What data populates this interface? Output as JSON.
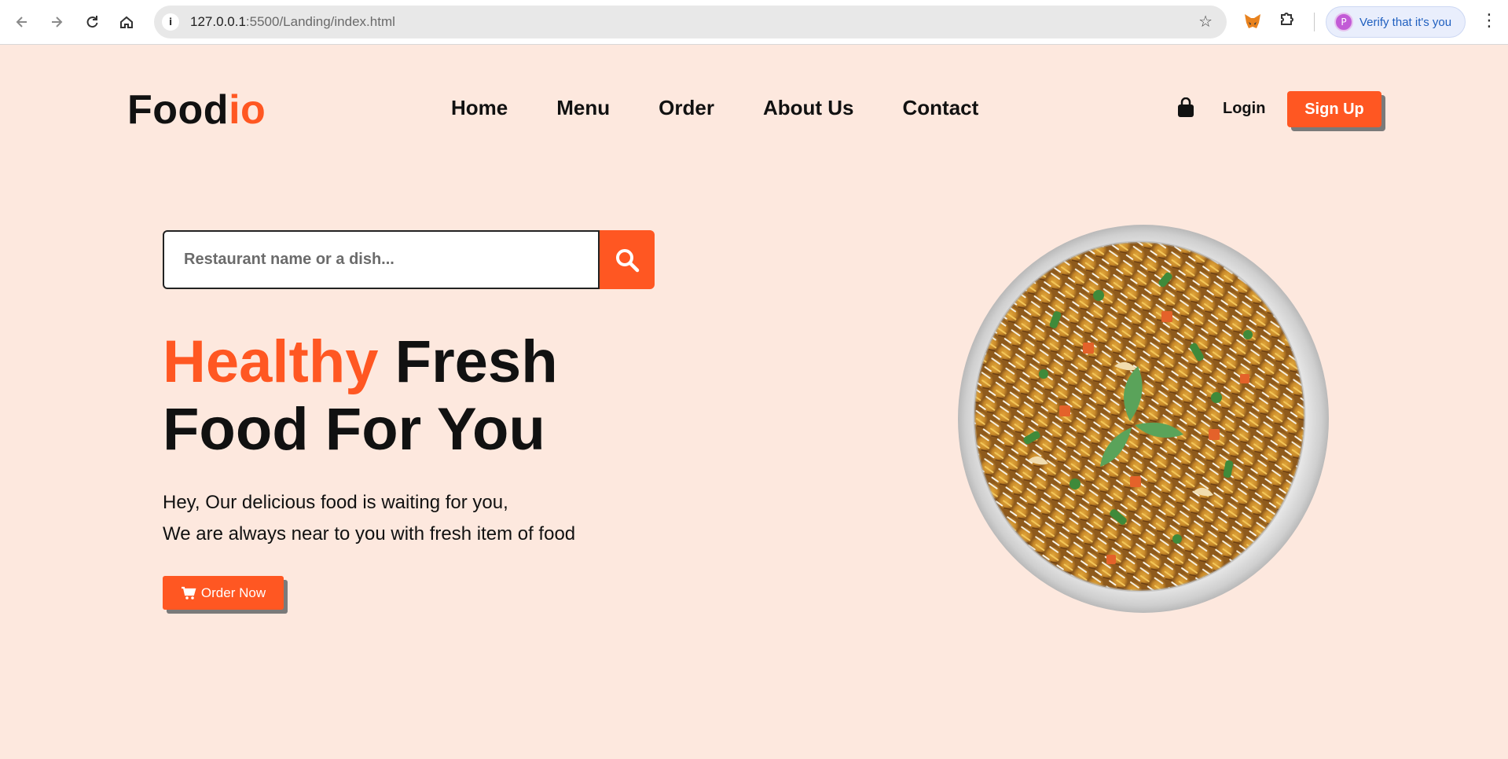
{
  "browser": {
    "url_host": "127.0.0.1",
    "url_path": ":5500/Landing/index.html",
    "profile_label": "Verify that it's you",
    "profile_initial": "P",
    "icons": [
      "back-icon",
      "forward-icon",
      "reload-icon",
      "home-icon",
      "site-info-icon",
      "bookmark-star-icon",
      "metamask-fox-icon",
      "extensions-puzzle-icon",
      "more-menu-icon"
    ]
  },
  "brand": {
    "prefix": "Food",
    "suffix": "io"
  },
  "nav": [
    "Home",
    "Menu",
    "Order",
    "About Us",
    "Contact"
  ],
  "header_actions": {
    "login": "Login",
    "signup": "Sign Up",
    "cart_icon": "shopping-bag-icon"
  },
  "search": {
    "placeholder": "Restaurant name or a dish...",
    "value": "",
    "icon": "search-icon"
  },
  "hero": {
    "headline_accent": "Healthy",
    "headline_rest_1": " Fresh",
    "headline_line_2": "Food For You",
    "desc_line_1": "Hey, Our delicious food is waiting for you,",
    "desc_line_2": "We are always near to you with fresh item of food",
    "cta": "Order Now",
    "cta_icon": "cart-icon"
  },
  "colors": {
    "accent": "#ff5722",
    "background": "#fde8de",
    "text": "#111111"
  }
}
